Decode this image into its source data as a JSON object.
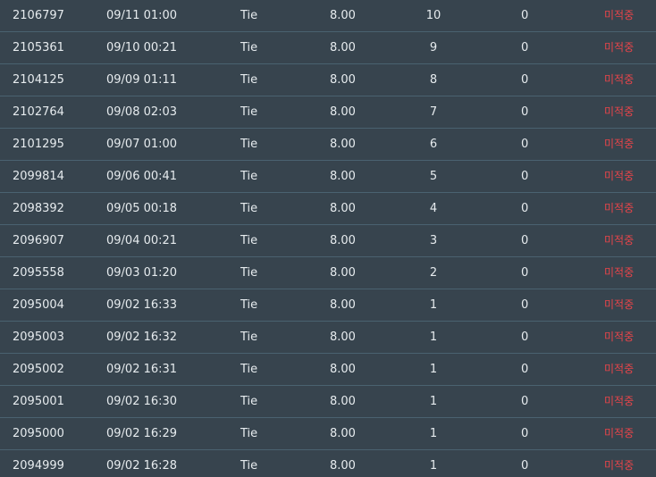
{
  "colors": {
    "background": "#37444e",
    "text": "#e6ebee",
    "status": "#e8454a",
    "divider": "#4a6270"
  },
  "rows": [
    {
      "id": "2106797",
      "date": "09/11 01:00",
      "pick": "Tie",
      "odds": "8.00",
      "round": "10",
      "win": "0",
      "status": "미적중"
    },
    {
      "id": "2105361",
      "date": "09/10 00:21",
      "pick": "Tie",
      "odds": "8.00",
      "round": "9",
      "win": "0",
      "status": "미적중"
    },
    {
      "id": "2104125",
      "date": "09/09 01:11",
      "pick": "Tie",
      "odds": "8.00",
      "round": "8",
      "win": "0",
      "status": "미적중"
    },
    {
      "id": "2102764",
      "date": "09/08 02:03",
      "pick": "Tie",
      "odds": "8.00",
      "round": "7",
      "win": "0",
      "status": "미적중"
    },
    {
      "id": "2101295",
      "date": "09/07 01:00",
      "pick": "Tie",
      "odds": "8.00",
      "round": "6",
      "win": "0",
      "status": "미적중"
    },
    {
      "id": "2099814",
      "date": "09/06 00:41",
      "pick": "Tie",
      "odds": "8.00",
      "round": "5",
      "win": "0",
      "status": "미적중"
    },
    {
      "id": "2098392",
      "date": "09/05 00:18",
      "pick": "Tie",
      "odds": "8.00",
      "round": "4",
      "win": "0",
      "status": "미적중"
    },
    {
      "id": "2096907",
      "date": "09/04 00:21",
      "pick": "Tie",
      "odds": "8.00",
      "round": "3",
      "win": "0",
      "status": "미적중"
    },
    {
      "id": "2095558",
      "date": "09/03 01:20",
      "pick": "Tie",
      "odds": "8.00",
      "round": "2",
      "win": "0",
      "status": "미적중"
    },
    {
      "id": "2095004",
      "date": "09/02 16:33",
      "pick": "Tie",
      "odds": "8.00",
      "round": "1",
      "win": "0",
      "status": "미적중"
    },
    {
      "id": "2095003",
      "date": "09/02 16:32",
      "pick": "Tie",
      "odds": "8.00",
      "round": "1",
      "win": "0",
      "status": "미적중"
    },
    {
      "id": "2095002",
      "date": "09/02 16:31",
      "pick": "Tie",
      "odds": "8.00",
      "round": "1",
      "win": "0",
      "status": "미적중"
    },
    {
      "id": "2095001",
      "date": "09/02 16:30",
      "pick": "Tie",
      "odds": "8.00",
      "round": "1",
      "win": "0",
      "status": "미적중"
    },
    {
      "id": "2095000",
      "date": "09/02 16:29",
      "pick": "Tie",
      "odds": "8.00",
      "round": "1",
      "win": "0",
      "status": "미적중"
    },
    {
      "id": "2094999",
      "date": "09/02 16:28",
      "pick": "Tie",
      "odds": "8.00",
      "round": "1",
      "win": "0",
      "status": "미적중"
    }
  ]
}
